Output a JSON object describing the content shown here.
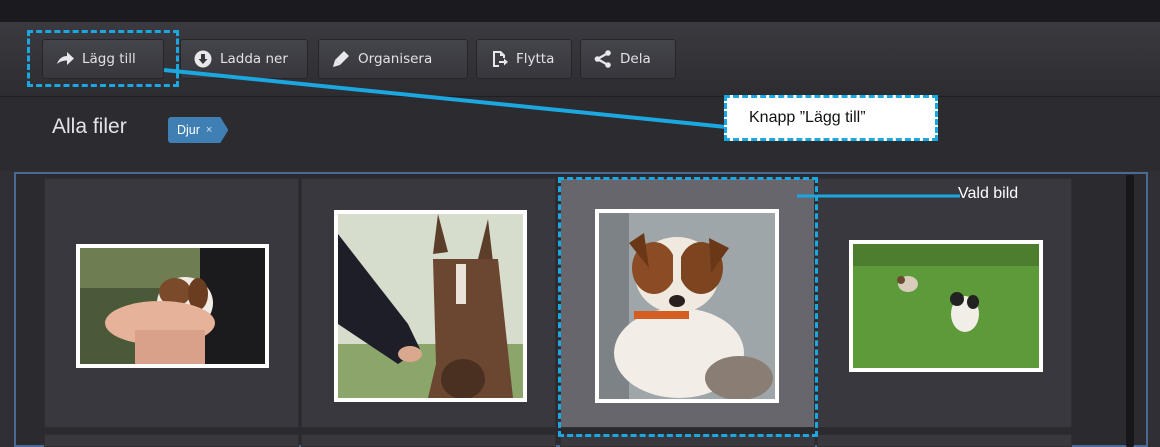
{
  "toolbar": {
    "add_label": "Lägg till",
    "download_label": "Ladda ner",
    "organize_label": "Organisera",
    "move_label": "Flytta",
    "share_label": "Dela"
  },
  "breadcrumb": {
    "title": "Alla filer",
    "filter_tag": "Djur",
    "filter_tag_remove": "×"
  },
  "gallery": {
    "thumbnails": [
      {
        "subject": "puppy held in hand",
        "selected": false
      },
      {
        "subject": "brown horse with hand",
        "selected": false
      },
      {
        "subject": "jack russell puppy",
        "selected": true
      },
      {
        "subject": "two dogs on grass",
        "selected": false
      }
    ]
  },
  "annotations": {
    "button_callout": "Knapp ”Lägg till”",
    "selected_label": "Vald bild",
    "highlight_color": "#1ba7e0"
  },
  "colors": {
    "tag": "#3f7fb4",
    "selected_cell": "#66666c",
    "grid_border": "#4a6a96"
  }
}
